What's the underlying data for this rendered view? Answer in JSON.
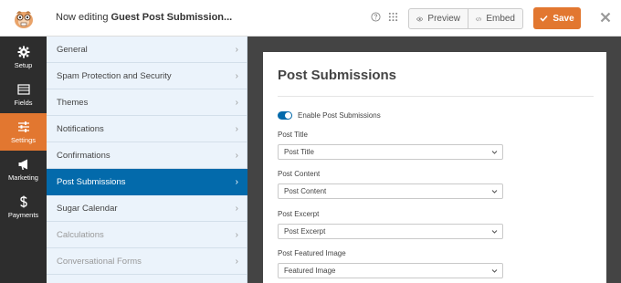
{
  "header": {
    "editing_prefix": "Now editing",
    "form_name": "Guest Post Submission...",
    "preview_label": "Preview",
    "embed_label": "Embed",
    "save_label": "Save",
    "icons": [
      "logo-icon",
      "help-icon",
      "grid-icon",
      "eye-icon",
      "code-icon",
      "checkmark-icon",
      "close-icon"
    ]
  },
  "leftnav": {
    "items": [
      {
        "label": "Setup",
        "icon": "gear-icon"
      },
      {
        "label": "Fields",
        "icon": "list-icon"
      },
      {
        "label": "Settings",
        "icon": "sliders-icon",
        "active": true
      },
      {
        "label": "Marketing",
        "icon": "megaphone-icon"
      },
      {
        "label": "Payments",
        "icon": "dollar-icon"
      }
    ]
  },
  "settings_menu": {
    "items": [
      {
        "label": "General"
      },
      {
        "label": "Spam Protection and Security"
      },
      {
        "label": "Themes"
      },
      {
        "label": "Notifications"
      },
      {
        "label": "Confirmations"
      },
      {
        "label": "Post Submissions",
        "active": true
      },
      {
        "label": "Sugar Calendar"
      },
      {
        "label": "Calculations",
        "muted": true
      },
      {
        "label": "Conversational Forms",
        "muted": true
      }
    ]
  },
  "panel": {
    "title": "Post Submissions",
    "enable_toggle": {
      "label": "Enable Post Submissions",
      "on": true
    },
    "fields": [
      {
        "label": "Post Title",
        "value": "Post Title"
      },
      {
        "label": "Post Content",
        "value": "Post Content"
      },
      {
        "label": "Post Excerpt",
        "value": "Post Excerpt"
      },
      {
        "label": "Post Featured Image",
        "value": "Featured Image"
      }
    ]
  },
  "colors": {
    "accent_orange": "#e27730",
    "active_blue": "#036aab",
    "nav_dark": "#2d2d2d",
    "menu_bg": "#ebf3fb"
  }
}
